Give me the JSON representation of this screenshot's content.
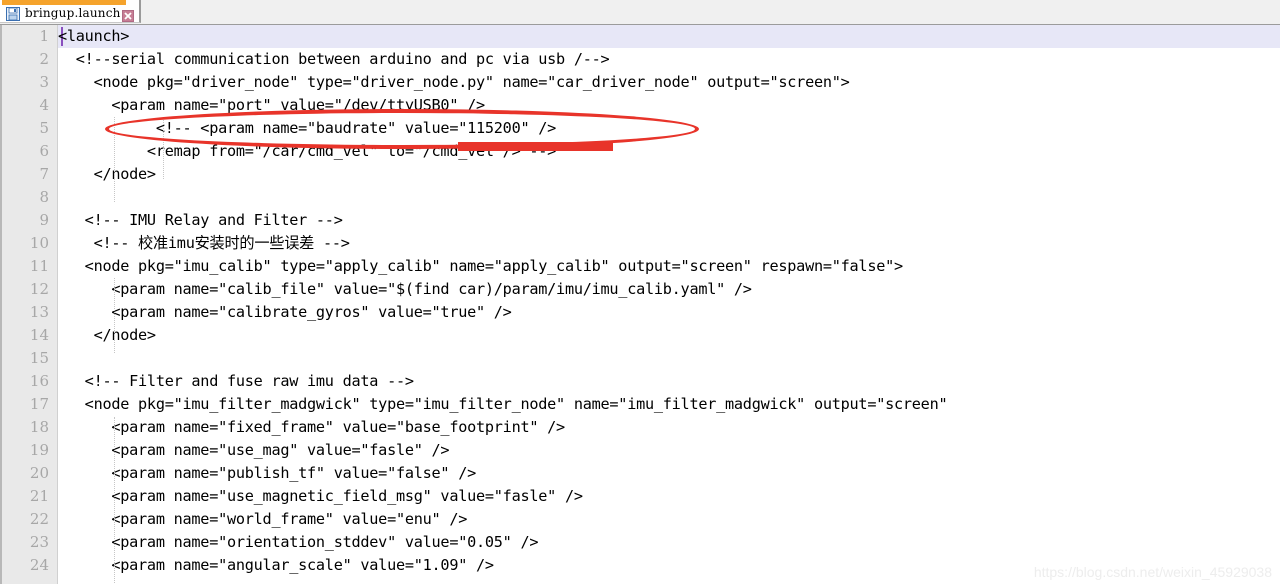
{
  "window": {
    "accent_color": "#f5a32c",
    "tab_bar_bg": "#f0f0f0"
  },
  "tab": {
    "label": "bringup.launch",
    "save_icon": "floppy-disk-save-icon",
    "close_icon": "close-x-icon"
  },
  "editor": {
    "gutter_bg": "#e9e9e9",
    "current_line_highlight": "#e7e7f7",
    "caret_color": "#8a4fbf",
    "first_visible_line": 1,
    "last_visible_line": 24,
    "line_numbers": [
      1,
      2,
      3,
      4,
      5,
      6,
      7,
      8,
      9,
      10,
      11,
      12,
      13,
      14,
      15,
      16,
      17,
      18,
      19,
      20,
      21,
      22,
      23,
      24
    ],
    "lines": [
      {
        "n": 1,
        "text": "<launch>"
      },
      {
        "n": 2,
        "text": "  <!--serial communication between arduino and pc via usb /-->"
      },
      {
        "n": 3,
        "text": "    <node pkg=\"driver_node\" type=\"driver_node.py\" name=\"car_driver_node\" output=\"screen\">"
      },
      {
        "n": 4,
        "text": "      <param name=\"port\" value=\"/dev/ttyUSB0\" />"
      },
      {
        "n": 5,
        "text": "           <!-- <param name=\"baudrate\" value=\"115200\" />"
      },
      {
        "n": 6,
        "text": "          <remap from=\"/car/cmd_vel\" to=\"/cmd_vel\"/> -->"
      },
      {
        "n": 7,
        "text": "    </node>"
      },
      {
        "n": 8,
        "text": ""
      },
      {
        "n": 9,
        "text": "   <!-- IMU Relay and Filter -->"
      },
      {
        "n": 10,
        "text": "    <!-- 校准imu安装时的一些误差 -->"
      },
      {
        "n": 11,
        "text": "   <node pkg=\"imu_calib\" type=\"apply_calib\" name=\"apply_calib\" output=\"screen\" respawn=\"false\">"
      },
      {
        "n": 12,
        "text": "      <param name=\"calib_file\" value=\"$(find car)/param/imu/imu_calib.yaml\" />"
      },
      {
        "n": 13,
        "text": "      <param name=\"calibrate_gyros\" value=\"true\" />"
      },
      {
        "n": 14,
        "text": "    </node>"
      },
      {
        "n": 15,
        "text": ""
      },
      {
        "n": 16,
        "text": "   <!-- Filter and fuse raw imu data -->"
      },
      {
        "n": 17,
        "text": "   <node pkg=\"imu_filter_madgwick\" type=\"imu_filter_node\" name=\"imu_filter_madgwick\" output=\"screen\""
      },
      {
        "n": 18,
        "text": "      <param name=\"fixed_frame\" value=\"base_footprint\" />"
      },
      {
        "n": 19,
        "text": "      <param name=\"use_mag\" value=\"fasle\" />"
      },
      {
        "n": 20,
        "text": "      <param name=\"publish_tf\" value=\"false\" />"
      },
      {
        "n": 21,
        "text": "      <param name=\"use_magnetic_field_msg\" value=\"fasle\" />"
      },
      {
        "n": 22,
        "text": "      <param name=\"world_frame\" value=\"enu\" />"
      },
      {
        "n": 23,
        "text": "      <param name=\"orientation_stddev\" value=\"0.05\" />"
      },
      {
        "n": 24,
        "text": "      <param name=\"angular_scale\" value=\"1.09\" />"
      }
    ]
  },
  "annotations": {
    "color": "#e8342a",
    "ellipse_target_line": 4,
    "ellipse_label": "red-ellipse-around-port-param",
    "underline_label": "red-underline-dev-ttyusb0",
    "underlined_text": "/dev/ttyUSB0"
  },
  "watermark": {
    "text": "https://blog.csdn.net/weixin_45929038"
  }
}
